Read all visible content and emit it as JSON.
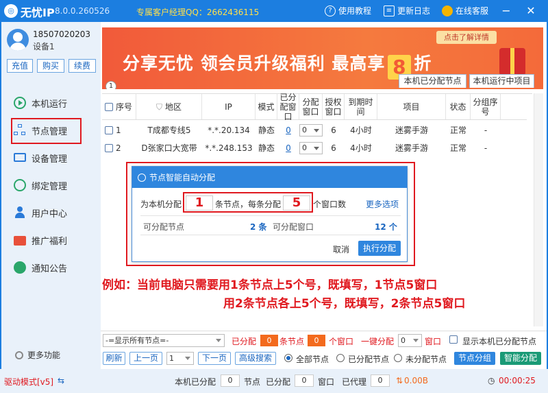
{
  "titlebar": {
    "app_name": "无忧IP",
    "version": "8.0.0.260526",
    "manager_qq": "专属客户经理QQ：2662436115",
    "tutorial": "使用教程",
    "changelog": "更新日志",
    "online_support": "在线客服"
  },
  "user": {
    "phone": "18507020203",
    "device": "设备1",
    "recharge": "充值",
    "buy": "购买",
    "renew": "续费"
  },
  "nav": {
    "items": [
      {
        "label": "本机运行"
      },
      {
        "label": "节点管理"
      },
      {
        "label": "设备管理"
      },
      {
        "label": "绑定管理"
      },
      {
        "label": "用户中心"
      },
      {
        "label": "推广福利"
      },
      {
        "label": "通知公告"
      }
    ],
    "more": "更多功能"
  },
  "banner": {
    "text_before": "分享无忧 领会员升级福利 最高享",
    "big": "8",
    "text_after": "折",
    "tag": "点击了解详情",
    "badge": "1"
  },
  "tabs": {
    "assigned": "本机已分配节点",
    "running": "本机运行中项目"
  },
  "table": {
    "headers": [
      "序号",
      "地区",
      "IP",
      "模式",
      "已分配窗口",
      "分配窗口",
      "授权窗口",
      "到期时间",
      "项目",
      "状态",
      "分组序号"
    ],
    "rows": [
      {
        "no": "1",
        "region": "T成都专线5",
        "ip": "*.*.20.134",
        "mode": "静态",
        "assigned": "0",
        "alloc": "0",
        "auth": "6",
        "expire": "4小时",
        "project": "迷雾手游",
        "state": "正常",
        "group": "-"
      },
      {
        "no": "2",
        "region": "D张家口大宽带",
        "ip": "*.*.248.153",
        "mode": "静态",
        "assigned": "0",
        "alloc": "0",
        "auth": "6",
        "expire": "4小时",
        "project": "迷雾手游",
        "state": "正常",
        "group": "-"
      }
    ]
  },
  "dialog": {
    "title": "节点智能自动分配",
    "prefix": "为本机分配",
    "nodes_value": "1",
    "middle": "条节点，每条分配",
    "windows_value": "5",
    "suffix": "个窗口数",
    "more": "更多选项",
    "avail_nodes_label": "可分配节点",
    "avail_nodes_value": "2 条",
    "avail_windows_label": "可分配窗口",
    "avail_windows_value": "12 个",
    "cancel": "取消",
    "execute": "执行分配"
  },
  "annotation": {
    "line1": "例如：当前电脑只需要用1条节点上5个号，既填写，1节点5窗口",
    "line2": "用2条节点各上5个号，既填写，2条节点5窗口"
  },
  "bottom": {
    "filter": "-=显示所有节点=-",
    "assigned_label": "已分配",
    "assigned_nodes": "0",
    "nodes_unit": "条节点",
    "assigned_windows": "0",
    "windows_unit": "个窗口",
    "one_key": "一键分配",
    "one_key_value": "0",
    "window_label": "窗口",
    "show_assigned": "显示本机已分配节点",
    "refresh": "刷新",
    "prev": "上一页",
    "page": "1",
    "next": "下一页",
    "advanced": "高级搜索",
    "radio_all": "全部节点",
    "radio_assigned": "已分配节点",
    "radio_unassigned": "未分配节点",
    "group": "节点分组",
    "smart": "智能分配"
  },
  "status": {
    "mode": "驱动模式[v5]",
    "local_assigned": "本机已分配",
    "local_value": "0",
    "nodes": "节点",
    "assigned": "已分配",
    "assigned_value": "0",
    "windows": "窗口",
    "proxied": "已代理",
    "proxied_value": "0",
    "traffic": "0.00B",
    "timer": "00:00:25"
  },
  "colors": {
    "brand": "#1c7ee0",
    "accent_red": "#e0191f",
    "banner": "#f15a3a"
  }
}
